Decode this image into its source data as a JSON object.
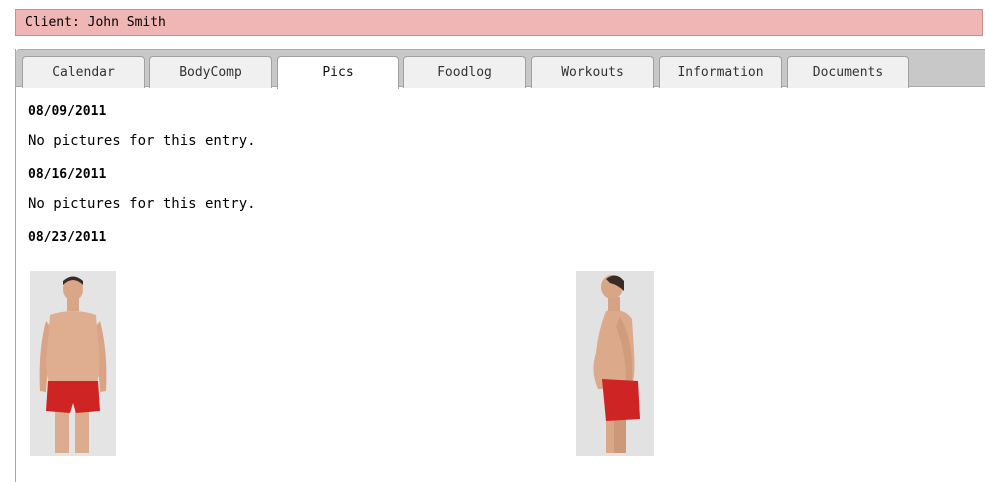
{
  "client": {
    "label": "Client: John Smith"
  },
  "tabs": [
    {
      "label": "Calendar",
      "active": false
    },
    {
      "label": "BodyComp",
      "active": false
    },
    {
      "label": "Pics",
      "active": true
    },
    {
      "label": "Foodlog",
      "active": false
    },
    {
      "label": "Workouts",
      "active": false
    },
    {
      "label": "Information",
      "active": false
    },
    {
      "label": "Documents",
      "active": false
    }
  ],
  "entries": [
    {
      "date": "08/09/2011",
      "message": "No pictures for this entry."
    },
    {
      "date": "08/16/2011",
      "message": "No pictures for this entry."
    },
    {
      "date": "08/23/2011",
      "photos": [
        "front-view-photo",
        "side-view-photo"
      ]
    }
  ]
}
